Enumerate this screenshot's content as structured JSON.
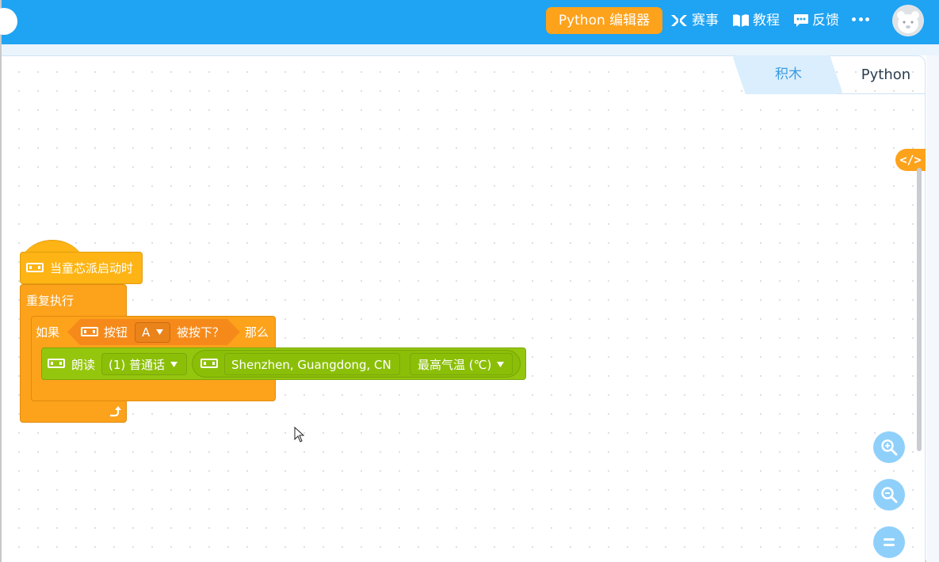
{
  "header": {
    "editor_button": "Python 编辑器",
    "nav": [
      {
        "label": "赛事",
        "icon": "contest-icon"
      },
      {
        "label": "教程",
        "icon": "book-icon"
      },
      {
        "label": "反馈",
        "icon": "feedback-icon"
      }
    ],
    "more_icon": "more-icon",
    "avatar_icon": "avatar-icon"
  },
  "tabs": [
    {
      "label": "积木",
      "active": true
    },
    {
      "label": "Python",
      "active": false
    }
  ],
  "code_toggle": "</>",
  "blocks": {
    "hat_label": "当童芯派启动时",
    "loop_label": "重复执行",
    "if_label": "如果",
    "then_label": "那么",
    "button_label": "按钮",
    "button_value": "A",
    "pressed_label": "被按下？",
    "speak_label": "朗读",
    "voice_value": "(1) 普通话",
    "location_value": "Shenzhen, Guangdong, CN",
    "weather_value": "最高气温 (℃)"
  },
  "zoom": [
    "zoom-in-icon",
    "zoom-out-icon",
    "zoom-reset-icon"
  ],
  "colors": {
    "topbar": "#1fa3f3",
    "accent_orange": "#fda21b",
    "event_yellow": "#fdb414",
    "green_block": "#95c60e"
  }
}
